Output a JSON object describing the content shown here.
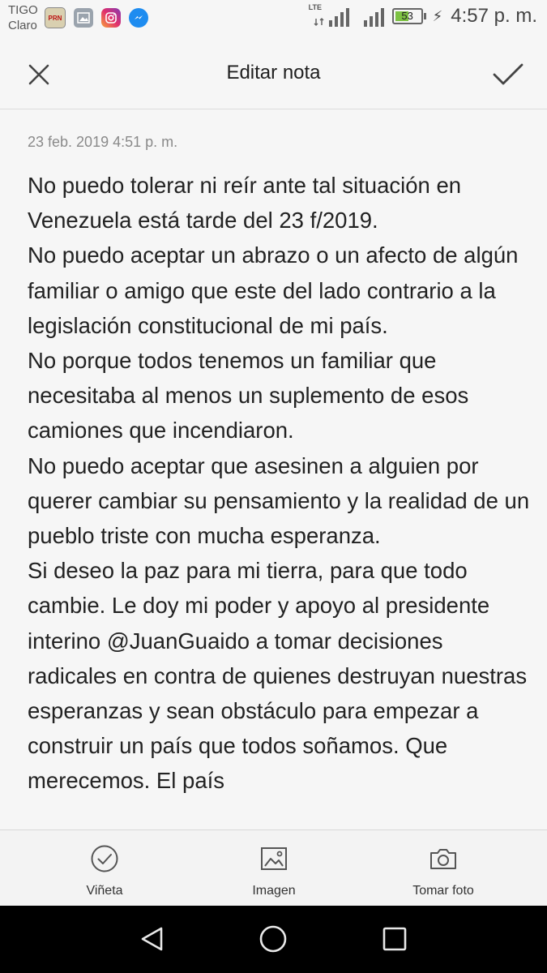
{
  "status_bar": {
    "carrier_line1": "TIGO",
    "carrier_line2": "Claro",
    "notification_icons": [
      "prn-app-icon",
      "gallery-icon",
      "instagram-icon",
      "messenger-icon"
    ],
    "prn_icon_text": "PRN",
    "network_label": "LTE",
    "battery_level": "53",
    "battery_fraction": 0.53,
    "charging": true,
    "time": "4:57 p. m."
  },
  "header": {
    "title": "Editar nota",
    "close_icon": "close-icon",
    "confirm_icon": "check-icon"
  },
  "note": {
    "timestamp": "23 feb. 2019 4:51 p. m.",
    "paragraphs": [
      "No puedo tolerar ni reír ante tal situación en Venezuela está tarde del 23 f/2019.",
      "No puedo aceptar un abrazo o un afecto de algún familiar o amigo que este del lado contrario a la legislación constitucional de mi país.",
      "No porque todos tenemos un familiar que necesitaba al menos un suplemento de esos camiones que incendiaron.",
      "No puedo aceptar que asesinen a alguien por querer cambiar su pensamiento y la realidad de un pueblo triste con mucha esperanza.",
      "Si deseo la paz para mi tierra, para que todo cambie. Le doy mi poder y apoyo al presidente interino @JuanGuaido a tomar decisiones radicales en contra de quienes destruyan nuestras esperanzas y sean obstáculo para empezar a construir un país que todos soñamos. Que merecemos. El país"
    ]
  },
  "toolbar": {
    "items": [
      {
        "label": "Viñeta",
        "icon": "checklist-circle-icon"
      },
      {
        "label": "Imagen",
        "icon": "image-icon"
      },
      {
        "label": "Tomar foto",
        "icon": "camera-icon"
      }
    ]
  },
  "nav_bar": {
    "buttons": [
      "back-icon",
      "home-icon",
      "recents-icon"
    ]
  },
  "colors": {
    "background": "#f6f6f6",
    "text": "#222222",
    "muted": "#8a8a8a",
    "nav_bar": "#000000",
    "battery_fill": "#7dc243"
  }
}
